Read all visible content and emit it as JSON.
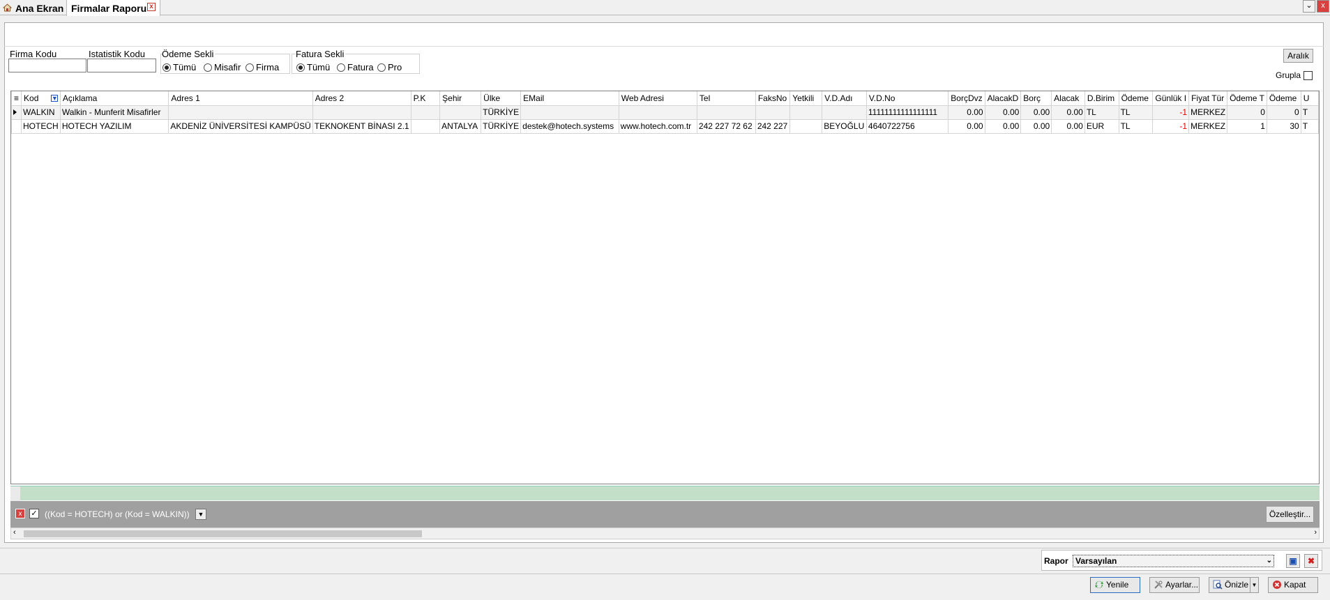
{
  "tabs": {
    "home": "Ana Ekran",
    "active": "Firmalar Raporu"
  },
  "filters": {
    "firma_kodu_label": "Firma Kodu",
    "istatistik_kodu_label": "Istatistik Kodu",
    "odeme_sekli": {
      "title": "Ödeme Sekli",
      "options": [
        "Tümü",
        "Misafir",
        "Firma"
      ],
      "selected": "Tümü"
    },
    "fatura_sekli": {
      "title": "Fatura Sekli",
      "options": [
        "Tümü",
        "Fatura",
        "Pro"
      ],
      "selected": "Tümü"
    },
    "aralik_button": "Aralık",
    "grupla_label": "Grupla"
  },
  "grid": {
    "columns": [
      "Kod",
      "Açıklama",
      "Adres 1",
      "Adres 2",
      "P.K",
      "Şehir",
      "Ülke",
      "EMail",
      "Web Adresi",
      "Tel",
      "FaksNo",
      "Yetkili",
      "V.D.Adı",
      "V.D.No",
      "BorçDvz",
      "AlacakD",
      "Borç",
      "Alacak",
      "D.Birim",
      "Ödeme",
      "Günlük I",
      "Fiyat Tür",
      "Ödeme T",
      "Ödeme",
      "U"
    ],
    "rows": [
      [
        "WALKIN",
        "Walkin - Munferit Misafirler",
        "",
        "",
        "",
        "",
        "TÜRKİYE",
        "",
        "",
        "",
        "",
        "",
        "",
        "11111111111111111",
        "0.00",
        "0.00",
        "0.00",
        "0.00",
        "TL",
        "TL",
        "-1",
        "MERKEZ",
        "0",
        "0",
        "T"
      ],
      [
        "HOTECH",
        "HOTECH YAZILIM",
        "AKDENİZ ÜNİVERSİTESİ KAMPÜSÜ",
        "TEKNOKENT BİNASI 2.1",
        "",
        "ANTALYA",
        "TÜRKİYE",
        "destek@hotech.systems",
        "www.hotech.com.tr",
        "242 227 72 62",
        "242 227",
        "",
        "BEYOĞLU",
        "4640722756",
        "0.00",
        "0.00",
        "0.00",
        "0.00",
        "EUR",
        "TL",
        "-1",
        "MERKEZ",
        "1",
        "30",
        "T"
      ]
    ]
  },
  "filter_bar": {
    "expression": "((Kod = HOTECH) or (Kod = WALKIN))",
    "customize_button": "Özelleştir..."
  },
  "report": {
    "label": "Rapor",
    "selected": "Varsayılan"
  },
  "actions": {
    "refresh": "Yenile",
    "settings": "Ayarlar...",
    "preview": "Önizle",
    "close": "Kapat"
  },
  "colors": {
    "group_strip": "#c3dfc8",
    "filter_bar": "#a0a0a0",
    "negative": "#dd0000",
    "close_red": "#c0392b"
  }
}
